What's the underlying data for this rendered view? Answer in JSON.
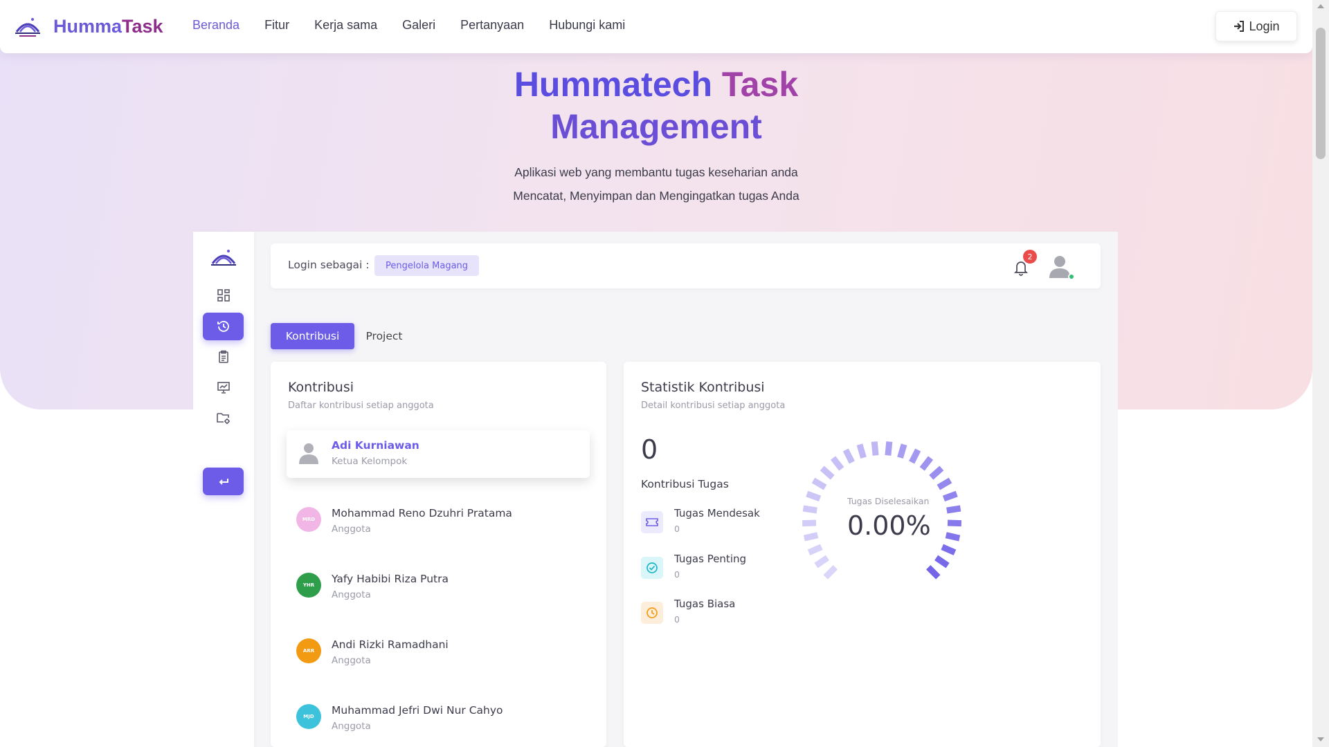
{
  "navbar": {
    "brand_part1": "Humma",
    "brand_part2": "Task",
    "links": [
      {
        "label": "Beranda",
        "active": true
      },
      {
        "label": "Fitur"
      },
      {
        "label": "Kerja sama"
      },
      {
        "label": "Galeri"
      },
      {
        "label": "Pertanyaan"
      },
      {
        "label": "Hubungi kami"
      }
    ],
    "login_label": "Login"
  },
  "hero": {
    "title_part1": "Hummatech",
    "title_part2": "Task",
    "title_line2": "Management",
    "subtitle_line1": "Aplikasi web yang membantu tugas keseharian anda",
    "subtitle_line2": "Mencatat, Menyimpan dan Mengingatkan tugas Anda"
  },
  "dashboard": {
    "topbar": {
      "login_as_label": "Login sebagai :",
      "role": "Pengelola Magang",
      "notification_count": "2"
    },
    "tabs": [
      {
        "label": "Kontribusi",
        "active": true
      },
      {
        "label": "Project"
      }
    ],
    "contributions": {
      "title": "Kontribusi",
      "subtitle": "Daftar kontribusi setiap anggota",
      "members": [
        {
          "name": "Adi Kurniawan",
          "role": "Ketua Kelompok",
          "initials": "",
          "color": "#b0b0b8",
          "highlighted": true
        },
        {
          "name": "Mohammad Reno Dzuhri Pratama",
          "role": "Anggota",
          "initials": "MRD",
          "color": "#f2b6e6"
        },
        {
          "name": "Yafy Habibi Riza Putra",
          "role": "Anggota",
          "initials": "YHR",
          "color": "#2e9e4a"
        },
        {
          "name": "Andi Rizki Ramadhani",
          "role": "Anggota",
          "initials": "ARR",
          "color": "#f29a12"
        },
        {
          "name": "Muhammad Jefri Dwi Nur Cahyo",
          "role": "Anggota",
          "initials": "MJD",
          "color": "#3cc3db"
        }
      ]
    },
    "statistics": {
      "title": "Statistik Kontribusi",
      "subtitle": "Detail kontribusi setiap anggota",
      "total_value": "0",
      "total_label": "Kontribusi Tugas",
      "tasks": [
        {
          "name": "Tugas Mendesak",
          "value": "0",
          "icon": "ticket-icon",
          "color": "#6c5ce7"
        },
        {
          "name": "Tugas Penting",
          "value": "0",
          "icon": "check-circle-icon",
          "color": "#1bb5c9"
        },
        {
          "name": "Tugas Biasa",
          "value": "0",
          "icon": "clock-icon",
          "color": "#f29a12"
        }
      ],
      "gauge_caption": "Tugas Diselesaikan",
      "gauge_value": "0.00%",
      "gauge_fraction": 0.5
    }
  },
  "colors": {
    "accent": "#6c5ce7",
    "brand_purple": "#8d2f8a"
  }
}
